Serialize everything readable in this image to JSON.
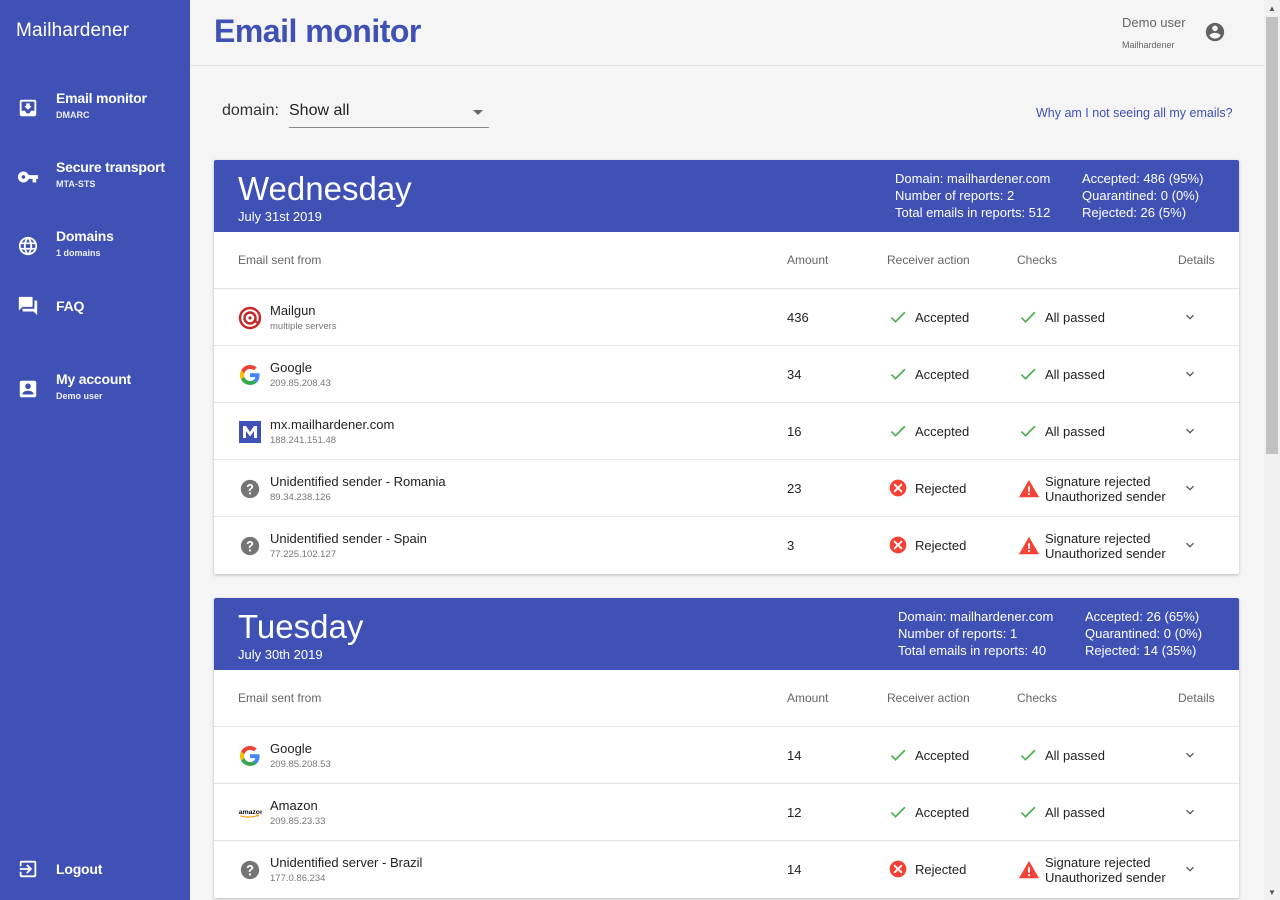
{
  "app": {
    "brand": "Mailhardener"
  },
  "sidebar": {
    "items": [
      {
        "label": "Email monitor",
        "sub": "DMARC",
        "icon": "inbox-icon"
      },
      {
        "label": "Secure transport",
        "sub": "MTA-STS",
        "icon": "key-icon"
      },
      {
        "label": "Domains",
        "sub": "1 domains",
        "icon": "globe-icon"
      },
      {
        "label": "FAQ",
        "sub": "",
        "icon": "chat-icon"
      },
      {
        "label": "My account",
        "sub": "Demo user",
        "icon": "account-box-icon"
      }
    ],
    "logout": {
      "label": "Logout",
      "icon": "logout-icon"
    }
  },
  "header": {
    "title": "Email monitor",
    "user_name": "Demo user",
    "user_org": "Mailhardener"
  },
  "filter": {
    "label": "domain:",
    "value": "Show all",
    "help_link": "Why am I not seeing all my emails?"
  },
  "columns": {
    "from": "Email sent from",
    "amount": "Amount",
    "action": "Receiver action",
    "checks": "Checks",
    "details": "Details"
  },
  "colors": {
    "primary": "#3f51b5",
    "success": "#4caf50",
    "error": "#f44336",
    "unknown": "#757575"
  },
  "reports": [
    {
      "day": "Wednesday",
      "date": "July 31st 2019",
      "stats": {
        "domain": "Domain: mailhardener.com",
        "reports": "Number of reports: 2",
        "total": "Total emails in reports: 512",
        "accepted": "Accepted: 486 (95%)",
        "quarantined": "Quarantined: 0 (0%)",
        "rejected": "Rejected: 26 (5%)"
      },
      "rows": [
        {
          "name": "Mailgun",
          "ip": "multiple servers",
          "amount": "436",
          "action": "Accepted",
          "checks": [
            "All passed"
          ],
          "icon": "mailgun-icon",
          "status": "ok"
        },
        {
          "name": "Google",
          "ip": "209.85.208.43",
          "amount": "34",
          "action": "Accepted",
          "checks": [
            "All passed"
          ],
          "icon": "google-icon",
          "status": "ok"
        },
        {
          "name": "mx.mailhardener.com",
          "ip": "188.241.151.48",
          "amount": "16",
          "action": "Accepted",
          "checks": [
            "All passed"
          ],
          "icon": "mailhardener-icon",
          "status": "ok"
        },
        {
          "name": "Unidentified sender - Romania",
          "ip": "89.34.238.126",
          "amount": "23",
          "action": "Rejected",
          "checks": [
            "Signature rejected",
            "Unauthorized sender"
          ],
          "icon": "help-circle-icon",
          "status": "fail"
        },
        {
          "name": "Unidentified sender - Spain",
          "ip": "77.225.102.127",
          "amount": "3",
          "action": "Rejected",
          "checks": [
            "Signature rejected",
            "Unauthorized sender"
          ],
          "icon": "help-circle-icon",
          "status": "fail"
        }
      ]
    },
    {
      "day": "Tuesday",
      "date": "July 30th 2019",
      "stats": {
        "domain": "Domain: mailhardener.com",
        "reports": "Number of reports: 1",
        "total": "Total emails in reports: 40",
        "accepted": "Accepted: 26 (65%)",
        "quarantined": "Quarantined: 0 (0%)",
        "rejected": "Rejected: 14 (35%)"
      },
      "rows": [
        {
          "name": "Google",
          "ip": "209.85.208.53",
          "amount": "14",
          "action": "Accepted",
          "checks": [
            "All passed"
          ],
          "icon": "google-icon",
          "status": "ok"
        },
        {
          "name": "Amazon",
          "ip": "209.85.23.33",
          "amount": "12",
          "action": "Accepted",
          "checks": [
            "All passed"
          ],
          "icon": "amazon-icon",
          "status": "ok"
        },
        {
          "name": "Unidentified server - Brazil",
          "ip": "177.0.86.234",
          "amount": "14",
          "action": "Rejected",
          "checks": [
            "Signature rejected",
            "Unauthorized sender"
          ],
          "icon": "help-circle-icon",
          "status": "fail"
        }
      ]
    }
  ]
}
